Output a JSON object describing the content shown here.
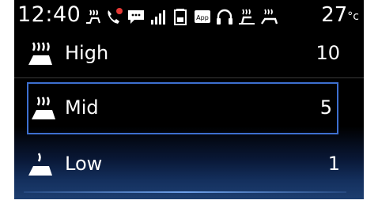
{
  "status": {
    "time": "12:40",
    "temperature": "27",
    "temperature_unit": "°c",
    "icons": [
      "seat-heat-status-icon",
      "phone-call-icon",
      "message-icon",
      "signal-icon",
      "battery-icon",
      "app-icon",
      "headphones-icon",
      "seat-heat-icon-1",
      "seat-heat-icon-2"
    ],
    "app_badge": "App"
  },
  "levels": [
    {
      "label": "High",
      "value": "10",
      "icon": "seat-heat-high-icon"
    },
    {
      "label": "Mid",
      "value": "5",
      "icon": "seat-heat-mid-icon"
    },
    {
      "label": "Low",
      "value": "1",
      "icon": "seat-heat-low-icon"
    }
  ],
  "selected_index": 1,
  "colors": {
    "background": "#000000",
    "selection_border": "#3d6fcf",
    "notification_red": "#e53935",
    "text": "#ffffff"
  }
}
